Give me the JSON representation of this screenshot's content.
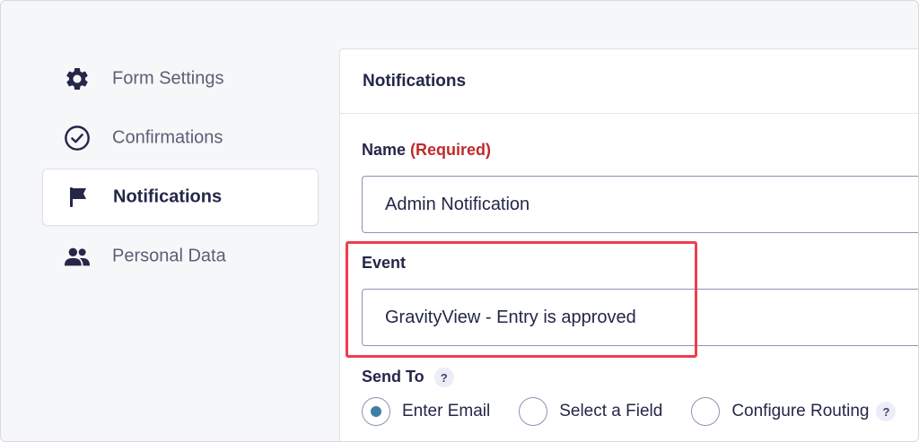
{
  "sidebar": {
    "items": [
      {
        "label": "Form Settings",
        "icon": "gear-icon",
        "active": false
      },
      {
        "label": "Confirmations",
        "icon": "check-circle-icon",
        "active": false
      },
      {
        "label": "Notifications",
        "icon": "flag-icon",
        "active": true
      },
      {
        "label": "Personal Data",
        "icon": "users-icon",
        "active": false
      }
    ]
  },
  "panel": {
    "title": "Notifications",
    "name_field": {
      "label": "Name",
      "required_text": "(Required)",
      "value": "Admin Notification"
    },
    "event_field": {
      "label": "Event",
      "value": "GravityView - Entry is approved"
    },
    "send_to": {
      "label": "Send To",
      "help": "?",
      "options": [
        {
          "label": "Enter Email",
          "selected": true
        },
        {
          "label": "Select a Field",
          "selected": false
        },
        {
          "label": "Configure Routing",
          "selected": false
        }
      ],
      "routing_help": "?"
    }
  },
  "colors": {
    "accent_radio": "#3e7da6",
    "required": "#c02b2b",
    "highlight_box": "#ef3d4e",
    "text_primary": "#242748",
    "text_muted": "#5b5e75"
  }
}
